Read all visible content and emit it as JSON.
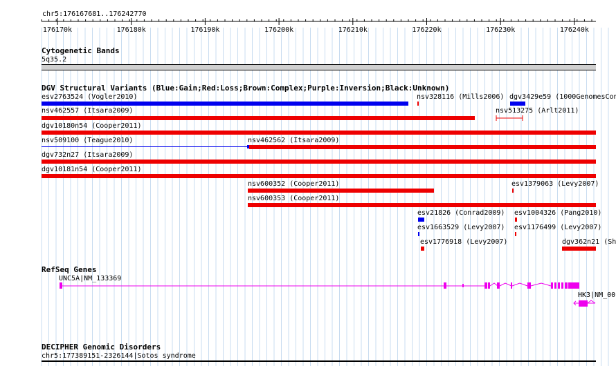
{
  "ruler": {
    "position": "chr5:176167681..176242770",
    "ticks": [
      "176170k",
      "176180k",
      "176190k",
      "176200k",
      "176210k",
      "176220k",
      "176230k",
      "176240k"
    ]
  },
  "tracks": {
    "cytoband": {
      "title": "Cytogenetic Bands",
      "band": "5q35.2"
    },
    "dgv": {
      "title": "DGV Structural Variants (Blue:Gain;Red:Loss;Brown:Complex;Purple:Inversion;Black:Unknown)",
      "colors": {
        "gain": "#0000ee",
        "loss": "#ee0000"
      },
      "features": [
        {
          "label": "esv2763524 (Vogler2010)",
          "type": "gain"
        },
        {
          "label": "nsv328116 (Mills2006)",
          "type": "loss"
        },
        {
          "label": "dgv3429e59 (1000GenomesCon",
          "type": "gain"
        },
        {
          "label": "nsv462557 (Itsara2009)",
          "type": "loss"
        },
        {
          "label": "nsv513275 (Arlt2011)",
          "type": "loss"
        },
        {
          "label": "dgv10180n54 (Cooper2011)",
          "type": "loss"
        },
        {
          "label": "nsv509100 (Teague2010)",
          "type": "gain"
        },
        {
          "label": "nsv462562 (Itsara2009)",
          "type": "loss"
        },
        {
          "label": "dgv732n27 (Itsara2009)",
          "type": "loss"
        },
        {
          "label": "dgv10181n54 (Cooper2011)",
          "type": "loss"
        },
        {
          "label": "nsv600352 (Cooper2011)",
          "type": "loss"
        },
        {
          "label": "esv1379063 (Levy2007)",
          "type": "loss"
        },
        {
          "label": "nsv600353 (Cooper2011)",
          "type": "loss"
        },
        {
          "label": "esv21826 (Conrad2009)",
          "type": "gain"
        },
        {
          "label": "esv1004326 (Pang2010)",
          "type": "loss"
        },
        {
          "label": "esv1663529 (Levy2007)",
          "type": "gain"
        },
        {
          "label": "esv1176499 (Levy2007)",
          "type": "loss"
        },
        {
          "label": "esv1776918 (Levy2007)",
          "type": "loss"
        },
        {
          "label": "dgv362n21 (Sh",
          "type": "loss"
        }
      ]
    },
    "refseq": {
      "title": "RefSeq Genes",
      "color": "#ee00ee",
      "genes": [
        {
          "label": "UNC5A|NM_133369"
        },
        {
          "label": "HK3|NM_00"
        }
      ]
    },
    "decipher": {
      "title": "DECIPHER Genomic Disorders",
      "entry": "chr5:177389151-2326144|Sotos syndrome"
    }
  }
}
